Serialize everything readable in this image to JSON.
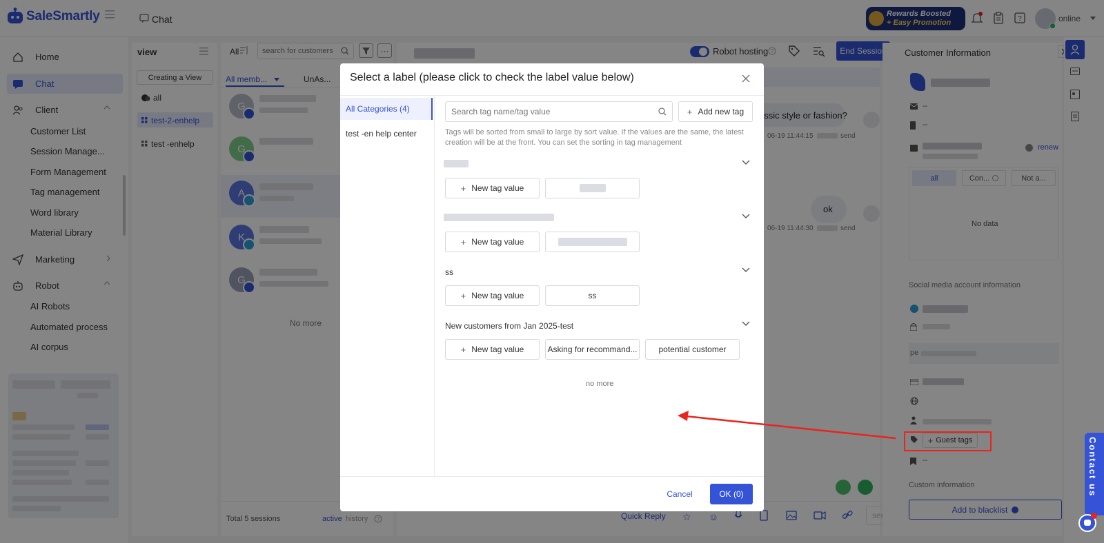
{
  "brand": {
    "name": "SaleSmartly"
  },
  "topbar": {
    "section_title": "Chat",
    "promo_line1": "Rewards Boosted",
    "promo_line2": "+ Easy Promotion",
    "status": "online"
  },
  "sidebar": {
    "home": "Home",
    "chat": "Chat",
    "client": "Client",
    "client_items": [
      "Customer List",
      "Session Manage...",
      "Form Management",
      "Tag management",
      "Word library",
      "Material Library"
    ],
    "marketing": "Marketing",
    "robot": "Robot",
    "robot_items": [
      "AI Robots",
      "Automated process",
      "AI corpus"
    ]
  },
  "views": {
    "title": "view",
    "create_button": "Creating a View",
    "items": [
      "all",
      "test-2-enhelp",
      "test -enhelp"
    ]
  },
  "sessions": {
    "filter_label": "All",
    "search_placeholder": "search for customers",
    "tab_members": "All memb...",
    "tab_unassigned": "UnAs...",
    "avatars": [
      "G",
      "G",
      "A",
      "K",
      "G"
    ],
    "no_more": "No more",
    "total": "Total 5 sessions",
    "active": "active",
    "history": "history"
  },
  "chat": {
    "robot_hosting": "Robot hosting",
    "end_session": "End Session",
    "msg1": "assic style or fashion?",
    "msg1_time": "06-19 11:44:15",
    "msg2": "ok",
    "msg2_time": "06-19 11:44:30",
    "sent_label": "send",
    "quick_reply": "Quick Reply",
    "send_button": "send"
  },
  "customer": {
    "title": "Customer Information",
    "dash": "--",
    "renew": "renew",
    "tab_all": "all",
    "tab_con": "Con...",
    "tab_not": "Not a...",
    "no_data": "No data",
    "social_title": "Social media account information",
    "pe_label": "pe",
    "guest_tags": "Guest tags",
    "custom_info": "Custom information",
    "blacklist": "Add to blacklist"
  },
  "modal": {
    "title": "Select a label (please click to check the label value below)",
    "categories": [
      "All Categories (4)",
      "test -en help center"
    ],
    "search_placeholder": "Search tag name/tag value",
    "add_tag": "Add new tag",
    "hint": "Tags will be sorted from small to large by sort value. If the values are the same, the latest creation will be at the front. You can set the sorting in tag management",
    "new_tag_value": "New tag value",
    "group3_name": "ss",
    "group3_value": "ss",
    "group4_name": "New customers from Jan 2025-test",
    "group4_values": [
      "Asking for recommand...",
      "potential customer"
    ],
    "no_more": "no more",
    "cancel": "Cancel",
    "ok": "OK (0)"
  },
  "contact": {
    "label": "Contact us"
  },
  "colors": {
    "brand": "#3553d6",
    "annotation": "#e8251f"
  }
}
